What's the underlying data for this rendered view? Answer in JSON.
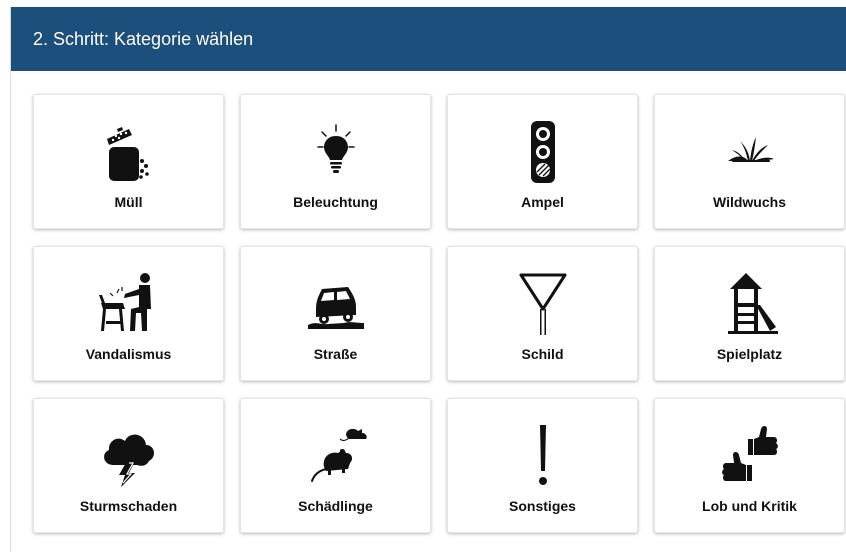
{
  "header": {
    "title": "2. Schritt: Kategorie wählen"
  },
  "categories": [
    {
      "label": "Müll",
      "icon": "trash-bin-icon"
    },
    {
      "label": "Beleuchtung",
      "icon": "light-bulb-icon"
    },
    {
      "label": "Ampel",
      "icon": "traffic-light-icon"
    },
    {
      "label": "Wildwuchs",
      "icon": "grass-icon"
    },
    {
      "label": "Vandalismus",
      "icon": "vandalism-icon"
    },
    {
      "label": "Straße",
      "icon": "car-road-icon"
    },
    {
      "label": "Schild",
      "icon": "yield-sign-icon"
    },
    {
      "label": "Spielplatz",
      "icon": "playground-icon"
    },
    {
      "label": "Sturmschaden",
      "icon": "storm-cloud-icon"
    },
    {
      "label": "Schädlinge",
      "icon": "rats-icon"
    },
    {
      "label": "Sonstiges",
      "icon": "exclamation-icon"
    },
    {
      "label": "Lob und Kritik",
      "icon": "thumbs-icon"
    }
  ],
  "colors": {
    "header_background": "#1d4f7c",
    "header_text": "#ffffff",
    "icon": "#111111"
  }
}
